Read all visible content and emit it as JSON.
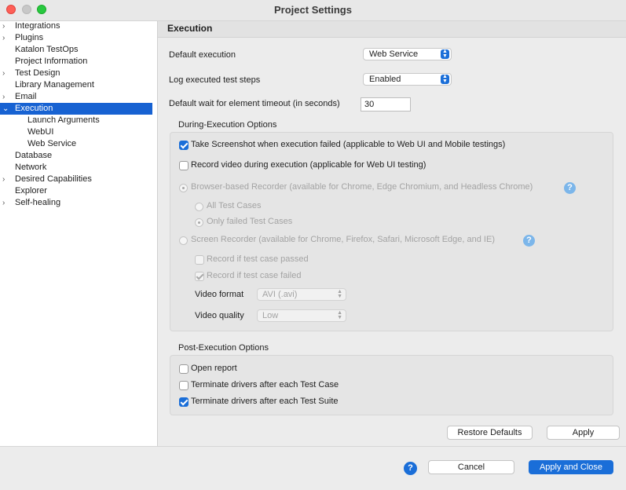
{
  "window": {
    "title": "Project Settings"
  },
  "sidebar": {
    "items": [
      {
        "label": "Integrations",
        "expandable": true
      },
      {
        "label": "Plugins",
        "expandable": true
      },
      {
        "label": "Katalon TestOps",
        "expandable": false
      },
      {
        "label": "Project Information",
        "expandable": false
      },
      {
        "label": "Test Design",
        "expandable": true
      },
      {
        "label": "Library Management",
        "expandable": false
      },
      {
        "label": "Email",
        "expandable": true
      },
      {
        "label": "Execution",
        "expandable": true,
        "expanded": true,
        "selected": true
      },
      {
        "label": "Launch Arguments",
        "child": true
      },
      {
        "label": "WebUI",
        "child": true
      },
      {
        "label": "Web Service",
        "child": true
      },
      {
        "label": "Database",
        "expandable": false
      },
      {
        "label": "Network",
        "expandable": false
      },
      {
        "label": "Desired Capabilities",
        "expandable": true
      },
      {
        "label": "Explorer",
        "expandable": false
      },
      {
        "label": "Self-healing",
        "expandable": true
      }
    ]
  },
  "main": {
    "title": "Execution",
    "default_execution": {
      "label": "Default execution",
      "value": "Web Service"
    },
    "log_steps": {
      "label": "Log executed test steps",
      "value": "Enabled"
    },
    "wait_timeout": {
      "label": "Default wait for element timeout (in seconds)",
      "value": "30"
    },
    "during": {
      "title": "During-Execution Options",
      "take_screenshot": {
        "label": "Take Screenshot when execution failed (applicable to Web UI and Mobile testings)",
        "checked": true
      },
      "record_video": {
        "label": "Record video during execution (applicable for Web UI testing)",
        "checked": false
      },
      "browser_recorder": {
        "label": "Browser-based Recorder (available for Chrome, Edge Chromium, and Headless Chrome)",
        "checked": true
      },
      "all_test_cases": {
        "label": "All Test Cases",
        "checked": false
      },
      "only_failed": {
        "label": "Only failed Test Cases",
        "checked": true
      },
      "screen_recorder": {
        "label": "Screen Recorder (available for Chrome, Firefox, Safari, Microsoft Edge, and IE)",
        "checked": false
      },
      "record_passed": {
        "label": "Record if test case passed",
        "checked": false
      },
      "record_failed": {
        "label": "Record if test case failed",
        "checked": true
      },
      "video_format": {
        "label": "Video format",
        "value": "AVI (.avi)"
      },
      "video_quality": {
        "label": "Video quality",
        "value": "Low"
      }
    },
    "post": {
      "title": "Post-Execution Options",
      "open_report": {
        "label": "Open report",
        "checked": false
      },
      "terminate_case": {
        "label": "Terminate drivers after each Test Case",
        "checked": false
      },
      "terminate_suite": {
        "label": "Terminate drivers after each Test Suite",
        "checked": true
      }
    },
    "restore_defaults": "Restore Defaults",
    "apply": "Apply"
  },
  "footer": {
    "help": "?",
    "cancel": "Cancel",
    "apply_close": "Apply and Close"
  },
  "colors": {
    "accent": "#1a6ed8",
    "selection": "#1762d2"
  }
}
